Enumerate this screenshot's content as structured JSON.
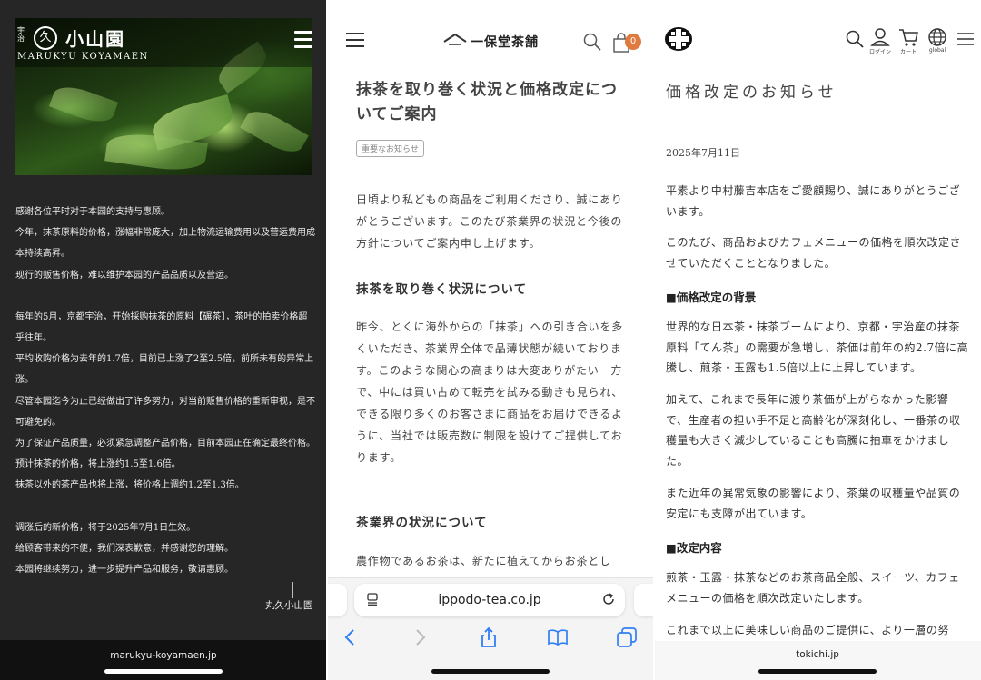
{
  "panel1": {
    "logo": {
      "small": "宇治",
      "mark": "久",
      "name": "小山園",
      "en": "MARUKYU KOYAMAEN"
    },
    "lines": [
      "感谢各位平时对于本园的支持与惠顾。",
      "今年，抹茶原料的价格，涨幅非常庞大，加上物流运输费用以及营运费用成本持续高昇。",
      "现行的贩售价格，难以维护本园的产品品质以及营运。",
      "",
      "每年的5月，京都宇治，开始採购抹茶的原料【碾茶】，茶叶的拍卖价格超乎往年。",
      "平均收购价格为去年的1.7倍，目前已上涨了2至2.5倍，前所未有的异常上涨。",
      "尽管本园迄今为止已经做出了许多努力，对当前贩售价格的重新审视，是不可避免的。",
      "为了保证产品质量，必须紧急调整产品价格，目前本园正在确定最终价格。",
      "预计抹茶的价格，将上涨约1.5至1.6倍。",
      "抹茶以外的茶产品也将上涨，将价格上调约1.2至1.3倍。",
      "",
      "调涨后的新价格，将于2025年7月1日生效。",
      "给顾客带来的不便，我们深表歉意，并感谢您的理解。",
      "本园将继续努力，进一步提升产品和服务，敬请惠顾。"
    ],
    "signature": "丸久小山園",
    "url": "marukyu-koyamaen.jp"
  },
  "panel2": {
    "brand": "一保堂茶舗",
    "cart_count": "0",
    "title": "抹茶を取り巻く状況と価格改定についてご案内",
    "tag": "重要なお知らせ",
    "intro": "日頃より私どもの商品をご利用くださり、誠にありがとうございます。このたび茶業界の状況と今後の方針についてご案内申し上げます。",
    "section1_heading": "抹茶を取り巻く状況について",
    "section1_body": "昨今、とくに海外からの「抹茶」への引き合いを多くいただき、茶業界全体で品薄状態が続いております。このような関心の高まりは大変ありがたい一方で、中には買い占めて転売を試みる動きも見られ、できる限り多くのお客さまに商品をお届けできるように、当社では販売数に制限を設けてご提供しております。",
    "section2_heading": "茶業界の状況について",
    "section2_body": "農作物であるお茶は、新たに植えてからお茶とし",
    "url": "ippodo-tea.co.jp"
  },
  "panel3": {
    "icons": [
      {
        "name": "search-icon",
        "label": ""
      },
      {
        "name": "user-icon",
        "label": "ログイン"
      },
      {
        "name": "cart-icon",
        "label": "カート"
      },
      {
        "name": "globe-icon",
        "label": "global"
      },
      {
        "name": "menu-icon",
        "label": ""
      }
    ],
    "title": "価格改定のお知らせ",
    "date": "2025年7月11日",
    "p1": "平素より中村藤吉本店をご愛顧賜り、誠にありがとうございます。",
    "p2": "このたび、商品およびカフェメニューの価格を順次改定させていただくこととなりました。",
    "h1": "■価格改定の背景",
    "p3": "世界的な日本茶・抹茶ブームにより、京都・宇治産の抹茶原料「てん茶」の需要が急増し、茶価は前年の約2.7倍に高騰し、煎茶・玉露も1.5倍以上に上昇しています。",
    "p4": "加えて、これまで長年に渡り茶価が上がらなかった影響で、生産者の担い手不足と高齢化が深刻化し、一番茶の収穫量も大きく減少していることも高騰に拍車をかけました。",
    "p5": "また近年の異常気象の影響により、茶葉の収穫量や品質の安定にも支障が出ています。",
    "h2": "■改定内容",
    "p6": "煎茶・玉露・抹茶などのお茶商品全般、スイーツ、カフェメニューの価格を順次改定いたします。",
    "p7": "これまで以上に美味しい商品のご提供に、より一層の努",
    "url": "tokichi.jp"
  }
}
